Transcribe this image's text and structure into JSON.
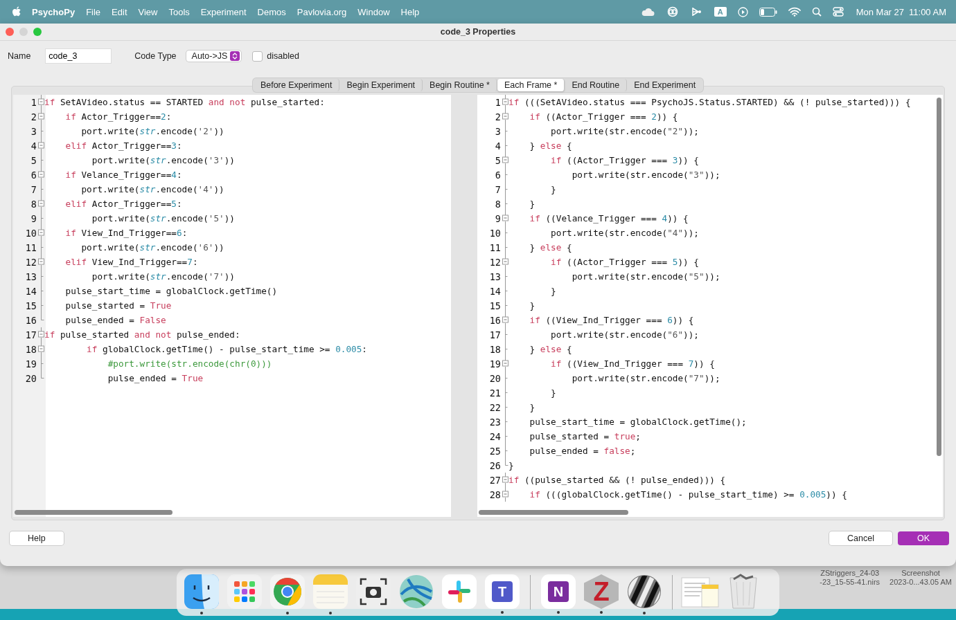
{
  "menu_bar": {
    "app": "PsychoPy",
    "menus": [
      "File",
      "Edit",
      "View",
      "Tools",
      "Experiment",
      "Demos",
      "Pavlovia.org",
      "Window",
      "Help"
    ],
    "input_source": "A",
    "date": "Mon Mar 27",
    "time": "11:00 AM"
  },
  "window": {
    "title": "code_3 Properties"
  },
  "fields": {
    "name_label": "Name",
    "name_value": "code_3",
    "code_type_label": "Code Type",
    "code_type_value": "Auto->JS",
    "disabled_label": "disabled",
    "disabled_checked": false
  },
  "tabs": [
    {
      "label": "Before Experiment",
      "selected": false
    },
    {
      "label": "Begin Experiment",
      "selected": false
    },
    {
      "label": "Begin Routine *",
      "selected": false
    },
    {
      "label": "Each Frame *",
      "selected": true
    },
    {
      "label": "End Routine",
      "selected": false
    },
    {
      "label": "End Experiment",
      "selected": false
    }
  ],
  "editors": [
    {
      "kind": "python",
      "lines": [
        {
          "number": "1",
          "kind": "fold-start",
          "tokens": [
            {
              "kind": "kw",
              "text": "if"
            },
            {
              "kind": "plain",
              "text": " SetAVideo.status == STARTED "
            },
            {
              "kind": "kw",
              "text": "and not"
            },
            {
              "kind": "plain",
              "text": " pulse_started:"
            }
          ]
        },
        {
          "number": "2",
          "kind": "fold-start",
          "tokens": [
            {
              "kind": "kw",
              "text": "    if"
            },
            {
              "kind": "plain",
              "text": " Actor_Trigger=="
            },
            {
              "kind": "num",
              "text": "2"
            },
            {
              "kind": "plain",
              "text": ":"
            }
          ]
        },
        {
          "number": "3",
          "kind": "body",
          "tokens": [
            {
              "kind": "plain",
              "text": "       port.write("
            },
            {
              "kind": "builtin",
              "text": "str"
            },
            {
              "kind": "plain",
              "text": ".encode("
            },
            {
              "kind": "str",
              "text": "'2'"
            },
            {
              "kind": "plain",
              "text": "))"
            }
          ]
        },
        {
          "number": "4",
          "kind": "fold-start",
          "tokens": [
            {
              "kind": "kw",
              "text": "    elif"
            },
            {
              "kind": "plain",
              "text": " Actor_Trigger=="
            },
            {
              "kind": "num",
              "text": "3"
            },
            {
              "kind": "plain",
              "text": ":"
            }
          ]
        },
        {
          "number": "5",
          "kind": "body",
          "tokens": [
            {
              "kind": "plain",
              "text": "         port.write("
            },
            {
              "kind": "builtin",
              "text": "str"
            },
            {
              "kind": "plain",
              "text": ".encode("
            },
            {
              "kind": "str",
              "text": "'3'"
            },
            {
              "kind": "plain",
              "text": "))"
            }
          ]
        },
        {
          "number": "6",
          "kind": "fold-start",
          "tokens": [
            {
              "kind": "kw",
              "text": "    if"
            },
            {
              "kind": "plain",
              "text": " Velance_Trigger=="
            },
            {
              "kind": "num",
              "text": "4"
            },
            {
              "kind": "plain",
              "text": ":"
            }
          ]
        },
        {
          "number": "7",
          "kind": "body",
          "tokens": [
            {
              "kind": "plain",
              "text": "       port.write("
            },
            {
              "kind": "builtin",
              "text": "str"
            },
            {
              "kind": "plain",
              "text": ".encode("
            },
            {
              "kind": "str",
              "text": "'4'"
            },
            {
              "kind": "plain",
              "text": "))"
            }
          ]
        },
        {
          "number": "8",
          "kind": "fold-start",
          "tokens": [
            {
              "kind": "kw",
              "text": "    elif"
            },
            {
              "kind": "plain",
              "text": " Actor_Trigger=="
            },
            {
              "kind": "num",
              "text": "5"
            },
            {
              "kind": "plain",
              "text": ":"
            }
          ]
        },
        {
          "number": "9",
          "kind": "body",
          "tokens": [
            {
              "kind": "plain",
              "text": "         port.write("
            },
            {
              "kind": "builtin",
              "text": "str"
            },
            {
              "kind": "plain",
              "text": ".encode("
            },
            {
              "kind": "str",
              "text": "'5'"
            },
            {
              "kind": "plain",
              "text": "))"
            }
          ]
        },
        {
          "number": "10",
          "kind": "fold-start",
          "tokens": [
            {
              "kind": "kw",
              "text": "    if"
            },
            {
              "kind": "plain",
              "text": " View_Ind_Trigger=="
            },
            {
              "kind": "num",
              "text": "6"
            },
            {
              "kind": "plain",
              "text": ":"
            }
          ]
        },
        {
          "number": "11",
          "kind": "body",
          "tokens": [
            {
              "kind": "plain",
              "text": "       port.write("
            },
            {
              "kind": "builtin",
              "text": "str"
            },
            {
              "kind": "plain",
              "text": ".encode("
            },
            {
              "kind": "str",
              "text": "'6'"
            },
            {
              "kind": "plain",
              "text": "))"
            }
          ]
        },
        {
          "number": "12",
          "kind": "fold-start",
          "tokens": [
            {
              "kind": "kw",
              "text": "    elif"
            },
            {
              "kind": "plain",
              "text": " View_Ind_Trigger=="
            },
            {
              "kind": "num",
              "text": "7"
            },
            {
              "kind": "plain",
              "text": ":"
            }
          ]
        },
        {
          "number": "13",
          "kind": "body",
          "tokens": [
            {
              "kind": "plain",
              "text": "         port.write("
            },
            {
              "kind": "builtin",
              "text": "str"
            },
            {
              "kind": "plain",
              "text": ".encode("
            },
            {
              "kind": "str",
              "text": "'7'"
            },
            {
              "kind": "plain",
              "text": "))"
            }
          ]
        },
        {
          "number": "14",
          "kind": "body",
          "tokens": [
            {
              "kind": "plain",
              "text": "    pulse_start_time = globalClock.getTime()"
            }
          ]
        },
        {
          "number": "15",
          "kind": "body",
          "tokens": [
            {
              "kind": "plain",
              "text": "    pulse_started = "
            },
            {
              "kind": "kw",
              "text": "True"
            }
          ]
        },
        {
          "number": "16",
          "kind": "fold-end",
          "tokens": [
            {
              "kind": "plain",
              "text": "    pulse_ended = "
            },
            {
              "kind": "kw",
              "text": "False"
            }
          ]
        },
        {
          "number": "17",
          "kind": "fold-start",
          "tokens": [
            {
              "kind": "kw",
              "text": "if"
            },
            {
              "kind": "plain",
              "text": " pulse_started "
            },
            {
              "kind": "kw",
              "text": "and not"
            },
            {
              "kind": "plain",
              "text": " pulse_ended:"
            }
          ]
        },
        {
          "number": "18",
          "kind": "fold-start",
          "tokens": [
            {
              "kind": "kw",
              "text": "        if"
            },
            {
              "kind": "plain",
              "text": " globalClock.getTime() - pulse_start_time >= "
            },
            {
              "kind": "num",
              "text": "0.005"
            },
            {
              "kind": "plain",
              "text": ":"
            }
          ]
        },
        {
          "number": "19",
          "kind": "body",
          "tokens": [
            {
              "kind": "comment",
              "text": "            #port.write(str.encode(chr(0)))"
            }
          ]
        },
        {
          "number": "20",
          "kind": "fold-end",
          "tokens": [
            {
              "kind": "plain",
              "text": "            pulse_ended = "
            },
            {
              "kind": "kw",
              "text": "True"
            }
          ]
        }
      ]
    },
    {
      "kind": "javascript",
      "lines": [
        {
          "number": "1",
          "kind": "fold-start",
          "tokens": [
            {
              "kind": "kw",
              "text": "if"
            },
            {
              "kind": "plain",
              "text": " (((SetAVideo.status === PsychoJS.Status.STARTED) && (! pulse_started))) {"
            }
          ]
        },
        {
          "number": "2",
          "kind": "fold-start",
          "tokens": [
            {
              "kind": "kw",
              "text": "    if"
            },
            {
              "kind": "plain",
              "text": " ((Actor_Trigger === "
            },
            {
              "kind": "num",
              "text": "2"
            },
            {
              "kind": "plain",
              "text": ")) {"
            }
          ]
        },
        {
          "number": "3",
          "kind": "body",
          "tokens": [
            {
              "kind": "plain",
              "text": "        port.write(str.encode("
            },
            {
              "kind": "str",
              "text": "\"2\""
            },
            {
              "kind": "plain",
              "text": "));"
            }
          ]
        },
        {
          "number": "4",
          "kind": "body",
          "tokens": [
            {
              "kind": "plain",
              "text": "    } "
            },
            {
              "kind": "kw",
              "text": "else"
            },
            {
              "kind": "plain",
              "text": " {"
            }
          ]
        },
        {
          "number": "5",
          "kind": "fold-start",
          "tokens": [
            {
              "kind": "kw",
              "text": "        if"
            },
            {
              "kind": "plain",
              "text": " ((Actor_Trigger === "
            },
            {
              "kind": "num",
              "text": "3"
            },
            {
              "kind": "plain",
              "text": ")) {"
            }
          ]
        },
        {
          "number": "6",
          "kind": "body",
          "tokens": [
            {
              "kind": "plain",
              "text": "            port.write(str.encode("
            },
            {
              "kind": "str",
              "text": "\"3\""
            },
            {
              "kind": "plain",
              "text": "));"
            }
          ]
        },
        {
          "number": "7",
          "kind": "body",
          "tokens": [
            {
              "kind": "plain",
              "text": "        }"
            }
          ]
        },
        {
          "number": "8",
          "kind": "body",
          "tokens": [
            {
              "kind": "plain",
              "text": "    }"
            }
          ]
        },
        {
          "number": "9",
          "kind": "fold-start",
          "tokens": [
            {
              "kind": "kw",
              "text": "    if"
            },
            {
              "kind": "plain",
              "text": " ((Velance_Trigger === "
            },
            {
              "kind": "num",
              "text": "4"
            },
            {
              "kind": "plain",
              "text": ")) {"
            }
          ]
        },
        {
          "number": "10",
          "kind": "body",
          "tokens": [
            {
              "kind": "plain",
              "text": "        port.write(str.encode("
            },
            {
              "kind": "str",
              "text": "\"4\""
            },
            {
              "kind": "plain",
              "text": "));"
            }
          ]
        },
        {
          "number": "11",
          "kind": "body",
          "tokens": [
            {
              "kind": "plain",
              "text": "    } "
            },
            {
              "kind": "kw",
              "text": "else"
            },
            {
              "kind": "plain",
              "text": " {"
            }
          ]
        },
        {
          "number": "12",
          "kind": "fold-start",
          "tokens": [
            {
              "kind": "kw",
              "text": "        if"
            },
            {
              "kind": "plain",
              "text": " ((Actor_Trigger === "
            },
            {
              "kind": "num",
              "text": "5"
            },
            {
              "kind": "plain",
              "text": ")) {"
            }
          ]
        },
        {
          "number": "13",
          "kind": "body",
          "tokens": [
            {
              "kind": "plain",
              "text": "            port.write(str.encode("
            },
            {
              "kind": "str",
              "text": "\"5\""
            },
            {
              "kind": "plain",
              "text": "));"
            }
          ]
        },
        {
          "number": "14",
          "kind": "body",
          "tokens": [
            {
              "kind": "plain",
              "text": "        }"
            }
          ]
        },
        {
          "number": "15",
          "kind": "body",
          "tokens": [
            {
              "kind": "plain",
              "text": "    }"
            }
          ]
        },
        {
          "number": "16",
          "kind": "fold-start",
          "tokens": [
            {
              "kind": "kw",
              "text": "    if"
            },
            {
              "kind": "plain",
              "text": " ((View_Ind_Trigger === "
            },
            {
              "kind": "num",
              "text": "6"
            },
            {
              "kind": "plain",
              "text": ")) {"
            }
          ]
        },
        {
          "number": "17",
          "kind": "body",
          "tokens": [
            {
              "kind": "plain",
              "text": "        port.write(str.encode("
            },
            {
              "kind": "str",
              "text": "\"6\""
            },
            {
              "kind": "plain",
              "text": "));"
            }
          ]
        },
        {
          "number": "18",
          "kind": "body",
          "tokens": [
            {
              "kind": "plain",
              "text": "    } "
            },
            {
              "kind": "kw",
              "text": "else"
            },
            {
              "kind": "plain",
              "text": " {"
            }
          ]
        },
        {
          "number": "19",
          "kind": "fold-start",
          "tokens": [
            {
              "kind": "kw",
              "text": "        if"
            },
            {
              "kind": "plain",
              "text": " ((View_Ind_Trigger === "
            },
            {
              "kind": "num",
              "text": "7"
            },
            {
              "kind": "plain",
              "text": ")) {"
            }
          ]
        },
        {
          "number": "20",
          "kind": "body",
          "tokens": [
            {
              "kind": "plain",
              "text": "            port.write(str.encode("
            },
            {
              "kind": "str",
              "text": "\"7\""
            },
            {
              "kind": "plain",
              "text": "));"
            }
          ]
        },
        {
          "number": "21",
          "kind": "body",
          "tokens": [
            {
              "kind": "plain",
              "text": "        }"
            }
          ]
        },
        {
          "number": "22",
          "kind": "body",
          "tokens": [
            {
              "kind": "plain",
              "text": "    }"
            }
          ]
        },
        {
          "number": "23",
          "kind": "body",
          "tokens": [
            {
              "kind": "plain",
              "text": "    pulse_start_time = globalClock.getTime();"
            }
          ]
        },
        {
          "number": "24",
          "kind": "body",
          "tokens": [
            {
              "kind": "plain",
              "text": "    pulse_started = "
            },
            {
              "kind": "kw",
              "text": "true"
            },
            {
              "kind": "plain",
              "text": ";"
            }
          ]
        },
        {
          "number": "25",
          "kind": "body",
          "tokens": [
            {
              "kind": "plain",
              "text": "    pulse_ended = "
            },
            {
              "kind": "kw",
              "text": "false"
            },
            {
              "kind": "plain",
              "text": ";"
            }
          ]
        },
        {
          "number": "26",
          "kind": "fold-end",
          "tokens": [
            {
              "kind": "plain",
              "text": "}"
            }
          ]
        },
        {
          "number": "27",
          "kind": "fold-start",
          "tokens": [
            {
              "kind": "kw",
              "text": "if"
            },
            {
              "kind": "plain",
              "text": " ((pulse_started && (! pulse_ended))) {"
            }
          ]
        },
        {
          "number": "28",
          "kind": "fold-start",
          "tokens": [
            {
              "kind": "kw",
              "text": "    if"
            },
            {
              "kind": "plain",
              "text": " (((globalClock.getTime() - pulse_start_time) >= "
            },
            {
              "kind": "num",
              "text": "0.005"
            },
            {
              "kind": "plain",
              "text": ")) {"
            }
          ]
        }
      ]
    }
  ],
  "buttons": {
    "help": "Help",
    "cancel": "Cancel",
    "ok": "OK"
  },
  "dock_groups": [
    {
      "items": [
        {
          "kind": "finder",
          "running": true
        },
        {
          "kind": "launchpad",
          "running": false
        },
        {
          "kind": "chrome",
          "running": true
        },
        {
          "kind": "notes",
          "running": true
        },
        {
          "kind": "screenshot",
          "running": false
        },
        {
          "kind": "globe",
          "running": false
        },
        {
          "kind": "slack",
          "running": false
        },
        {
          "kind": "teams",
          "glyph": "T",
          "running": true
        }
      ]
    },
    {
      "items": [
        {
          "kind": "onenote",
          "glyph": "N",
          "running": true
        },
        {
          "kind": "zotero",
          "glyph": "Z",
          "running": true
        },
        {
          "kind": "stripes",
          "running": true
        }
      ]
    },
    {
      "items": [
        {
          "kind": "documents",
          "running": false
        },
        {
          "kind": "trash",
          "running": false
        }
      ]
    }
  ],
  "desktop_files": [
    {
      "lines": [
        "ZStriggers_24-03",
        "-23_15-55-41.nirs"
      ]
    },
    {
      "lines": [
        "Screenshot",
        "2023-0...43.05 AM"
      ]
    }
  ]
}
